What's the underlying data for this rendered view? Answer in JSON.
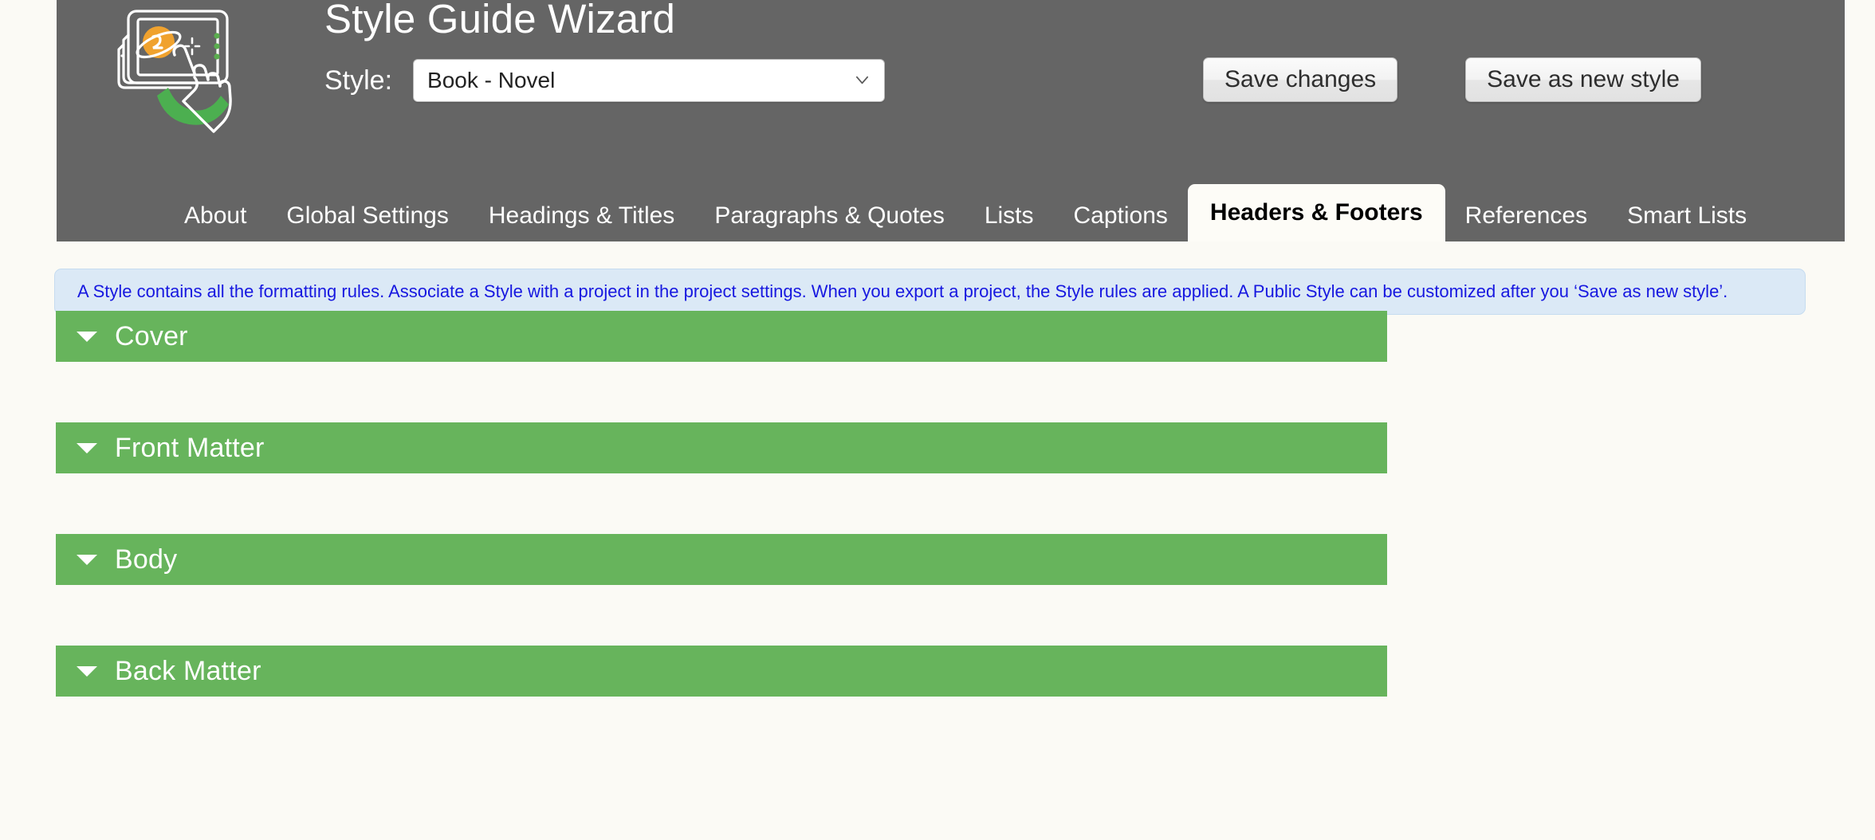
{
  "header": {
    "title": "Style Guide Wizard",
    "logo_icon": "tablet-hand-planet-logo",
    "style_label": "Style:",
    "style_selected": "Book - Novel",
    "style_chevron_icon": "chevron-down-icon",
    "buttons": {
      "save_changes": "Save changes",
      "save_as_new_style": "Save as new style"
    },
    "background_color": "#656565"
  },
  "tabs": [
    {
      "label": "About",
      "active": false
    },
    {
      "label": "Global Settings",
      "active": false
    },
    {
      "label": "Headings & Titles",
      "active": false
    },
    {
      "label": "Paragraphs & Quotes",
      "active": false
    },
    {
      "label": "Lists",
      "active": false
    },
    {
      "label": "Captions",
      "active": false
    },
    {
      "label": "Headers & Footers",
      "active": true
    },
    {
      "label": "References",
      "active": false
    },
    {
      "label": "Smart Lists",
      "active": false
    }
  ],
  "info_bar": {
    "text": "A Style contains all the formatting rules. Associate a Style with a project in the project settings. When you export a project, the Style rules are applied. A Public Style can be customized after you ‘Save as new style’.",
    "text_color": "#1718e0",
    "background_color": "#dbe9f6"
  },
  "sections": [
    {
      "label": "Cover",
      "expanded": false,
      "toggle_icon": "triangle-down-icon"
    },
    {
      "label": "Front Matter",
      "expanded": false,
      "toggle_icon": "triangle-down-icon"
    },
    {
      "label": "Body",
      "expanded": false,
      "toggle_icon": "triangle-down-icon"
    },
    {
      "label": "Back Matter",
      "expanded": false,
      "toggle_icon": "triangle-down-icon"
    }
  ],
  "colors": {
    "page_background": "#fbfaf5",
    "header": "#656565",
    "accordion_green": "#67b45c",
    "active_tab": "#fdfcf7"
  }
}
